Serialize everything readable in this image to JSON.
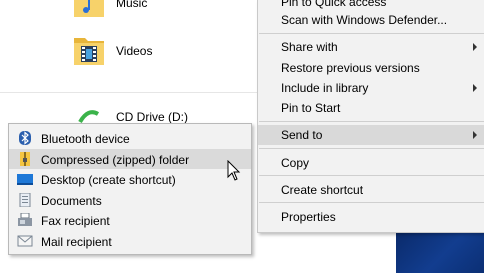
{
  "explorer": {
    "items": [
      {
        "label": "Music",
        "icon": "music-folder-icon"
      },
      {
        "label": "Videos",
        "icon": "videos-folder-icon"
      },
      {
        "label": "CD Drive (D:)",
        "icon": "cd-drive-icon"
      }
    ]
  },
  "context_menu": {
    "items": [
      {
        "label": "Pin to Quick access"
      },
      {
        "label": "Scan with Windows Defender..."
      },
      {
        "label": "Share with"
      },
      {
        "label": "Restore previous versions"
      },
      {
        "label": "Include in library"
      },
      {
        "label": "Pin to Start"
      },
      {
        "label": "Send to"
      },
      {
        "label": "Copy"
      },
      {
        "label": "Create shortcut"
      },
      {
        "label": "Properties"
      }
    ]
  },
  "send_to_menu": {
    "items": [
      {
        "label": "Bluetooth device",
        "icon": "bluetooth-icon"
      },
      {
        "label": "Compressed (zipped) folder",
        "icon": "zip-folder-icon"
      },
      {
        "label": "Desktop (create shortcut)",
        "icon": "desktop-icon"
      },
      {
        "label": "Documents",
        "icon": "documents-icon"
      },
      {
        "label": "Fax recipient",
        "icon": "fax-icon"
      },
      {
        "label": "Mail recipient",
        "icon": "mail-icon"
      }
    ]
  },
  "colors": {
    "menu_bg": "#f2f2f2",
    "highlight": "#d9d9d9",
    "folder": "#f4c542",
    "desktop": "#123d8f"
  }
}
